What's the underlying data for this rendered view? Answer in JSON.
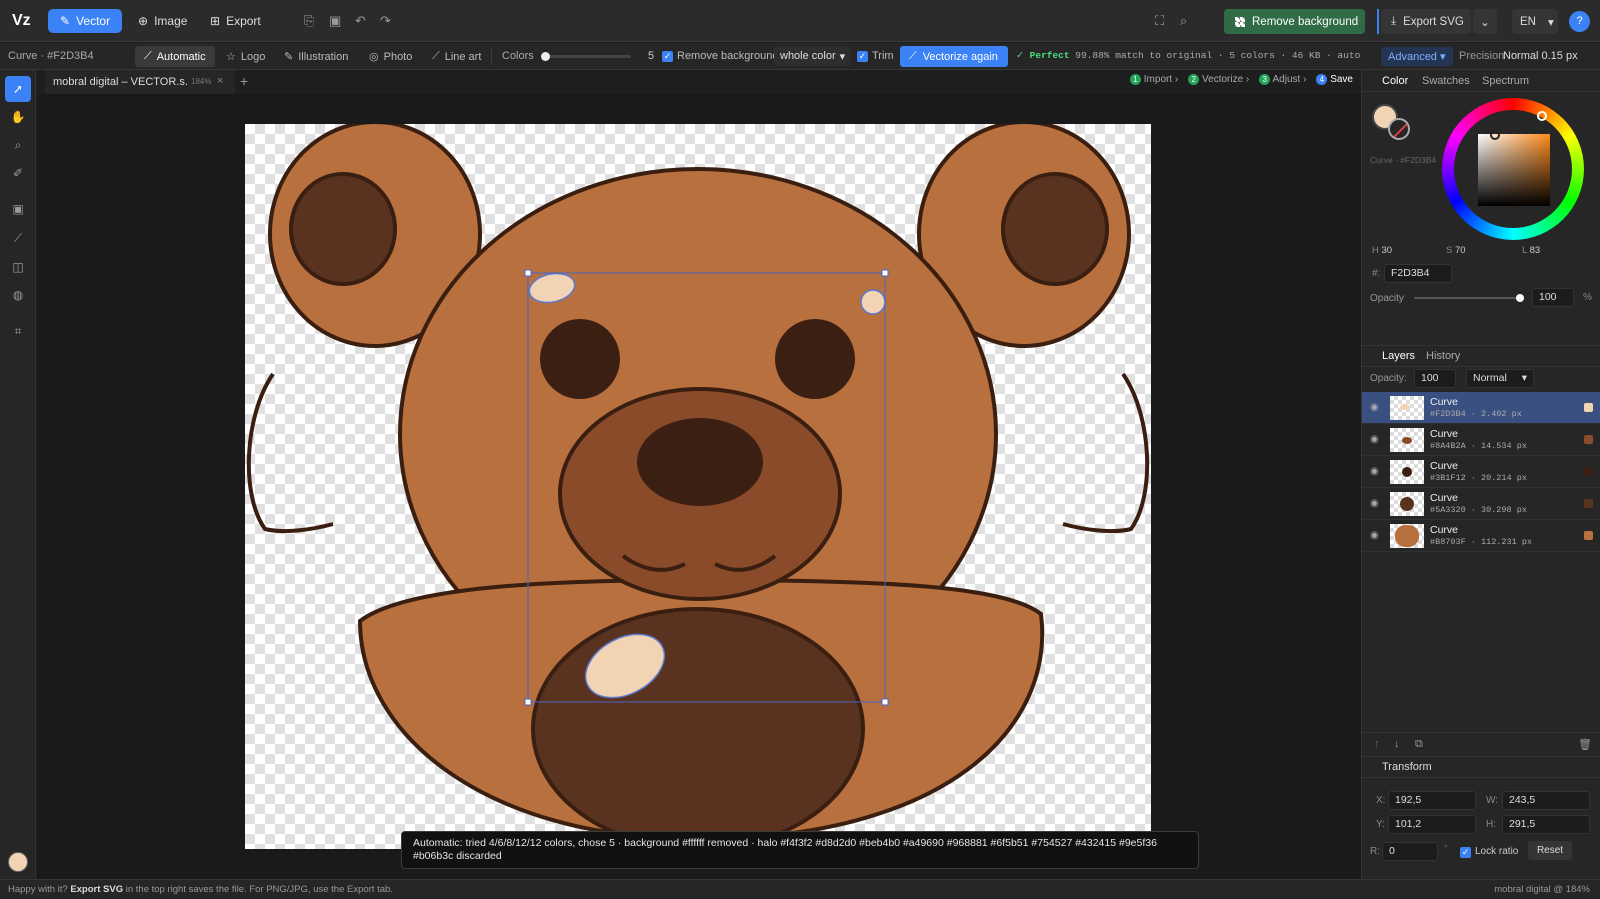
{
  "app": {
    "logo": "Vz"
  },
  "modes": [
    {
      "label": "Vector"
    },
    {
      "label": "Image"
    },
    {
      "label": "Export"
    }
  ],
  "top_right": {
    "remove_bg": "Remove background",
    "export_svg": "Export SVG",
    "lang": "EN",
    "help": "?"
  },
  "toolbar": {
    "selection": "Curve · #F2D3B4",
    "presets": [
      "Automatic",
      "Logo",
      "Illustration",
      "Photo",
      "Line art"
    ],
    "colors_label": "Colors",
    "colors_value": "5",
    "remove_bg_label": "Remove background",
    "remove_mode": "whole color",
    "trim_label": "Trim",
    "vectorize_again": "Vectorize again",
    "match_status": "Perfect",
    "match_text": "99.88% match to original · 5 colors · 46 KB · auto",
    "advanced": "Advanced",
    "precision_label": "Precision",
    "precision_value": "Normal 0.15 px"
  },
  "document": {
    "tab_name": "mobral digital – VECTOR.s...",
    "zoom": "184%",
    "close": "×",
    "add": "+"
  },
  "steps": [
    {
      "n": "1",
      "label": "Import"
    },
    {
      "n": "2",
      "label": "Vectorize"
    },
    {
      "n": "3",
      "label": "Adjust"
    },
    {
      "n": "4",
      "label": "Save"
    }
  ],
  "color_panel": {
    "tabs": [
      "Color",
      "Swatches",
      "Spectrum"
    ],
    "caption": "Curve · #F2D3B4",
    "fill_color": "#F2D3B4",
    "h_label": "H",
    "h": "30",
    "s_label": "S",
    "s": "70",
    "l_label": "L",
    "l": "83",
    "hex_label": "#:",
    "hex": "F2D3B4",
    "opacity_label": "Opacity",
    "opacity": "100",
    "opacity_unit": "%"
  },
  "layers_panel": {
    "tabs": [
      "Layers",
      "History"
    ],
    "opacity_label": "Opacity:",
    "opacity": "100",
    "blend": "Normal",
    "layers": [
      {
        "name": "Curve",
        "meta": "#F2D3B4 · 2.402 px",
        "color": "#F2D3B4",
        "selected": true
      },
      {
        "name": "Curve",
        "meta": "#8A4B2A · 14.534 px",
        "color": "#8A4B2A",
        "selected": false
      },
      {
        "name": "Curve",
        "meta": "#3B1F12 · 20.214 px",
        "color": "#3B1F12",
        "selected": false
      },
      {
        "name": "Curve",
        "meta": "#5A3320 · 30.298 px",
        "color": "#5A3320",
        "selected": false
      },
      {
        "name": "Curve",
        "meta": "#B8703F · 112.231 px",
        "color": "#B8703F",
        "selected": false
      }
    ]
  },
  "transform": {
    "title": "Transform",
    "x_label": "X:",
    "x": "192,5",
    "w_label": "W:",
    "w": "243,5",
    "y_label": "Y:",
    "y": "101,2",
    "h_label": "H:",
    "h": "291,5",
    "r_label": "R:",
    "r": "0",
    "deg": "°",
    "lock_label": "Lock ratio",
    "reset": "Reset"
  },
  "tooltip": "Automatic: tried 4/6/8/12/12 colors, chose 5 · background #ffffff removed · halo #f4f3f2 #d8d2d0 #beb4b0 #a49690 #968881 #6f5b51 #754527 #432415 #9e5f36 #b06b3c discarded",
  "status": {
    "left_prefix": "Happy with it? ",
    "left_bold": "Export SVG",
    "left_suffix": " in the top right saves the file. For PNG/JPG, use the Export tab.",
    "right": "mobral digital @ 184%"
  },
  "colors": {
    "accent": "#3b82f6",
    "green": "#2f6b45",
    "bear_fur": "#B8703F",
    "bear_dark": "#5A3320",
    "bear_muzzle": "#8A4B2A",
    "bear_eye": "#3B1F12",
    "highlight": "#F2D3B4"
  }
}
